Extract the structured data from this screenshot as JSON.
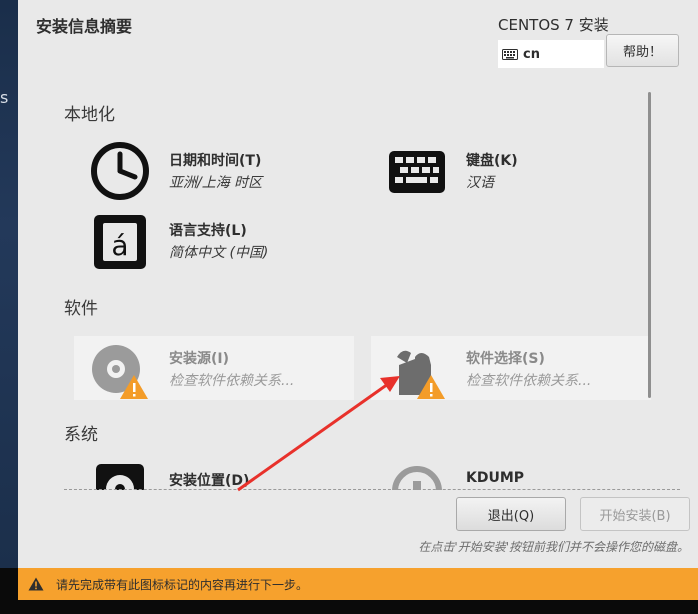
{
  "window": {
    "title": "安装信息摘要",
    "product": "CENTOS 7 安装",
    "keyboard_layout": "cn",
    "help_label": "帮助！"
  },
  "sections": {
    "localization": "本地化",
    "software": "软件",
    "system": "系统"
  },
  "spokes": {
    "datetime": {
      "title": "日期和时间(T)",
      "status": "亚洲/上海 时区"
    },
    "keyboard": {
      "title": "键盘(K)",
      "status": "汉语"
    },
    "language": {
      "title": "语言支持(L)",
      "status": "简体中文 (中国)"
    },
    "source": {
      "title": "安装源(I)",
      "status": "检查软件依赖关系..."
    },
    "software_selection": {
      "title": "软件选择(S)",
      "status": "检查软件依赖关系..."
    },
    "destination": {
      "title": "安装位置(D)"
    },
    "kdump": {
      "title": "KDUMP"
    }
  },
  "buttons": {
    "quit": "退出(Q)",
    "begin": "开始安装(B)"
  },
  "note": "在点击'开始安装'按钮前我们并不会操作您的磁盘。",
  "warning": "请先完成带有此图标标记的内容再进行下一步。",
  "left_glyph": "s",
  "colors": {
    "warning_bar": "#f6a12d",
    "annotation_arrow": "#e8312b",
    "background": "#e9e9e9"
  },
  "icons": {
    "datetime": "clock-icon",
    "keyboard": "keyboard-icon",
    "language": "language-icon",
    "source": "disc-icon",
    "software_selection": "package-icon",
    "destination": "harddrive-icon",
    "kdump": "kdump-icon",
    "warning": "warning-icon"
  }
}
